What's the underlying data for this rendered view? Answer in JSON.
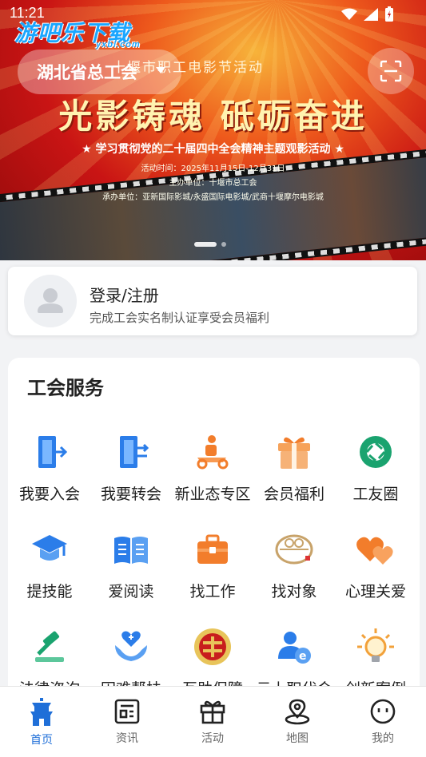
{
  "status_bar": {
    "time": "11:21"
  },
  "watermark": {
    "brand": "游吧乐下载",
    "domain": "yxbl.com"
  },
  "header": {
    "region": "湖北省总工会"
  },
  "banner": {
    "event_line": "十堰市职工电影节活动",
    "headline": "光影铸魂  砥砺奋进",
    "subtitle": "★ 学习贯彻党的二十届四中全会精神主题观影活动 ★",
    "activity_time": "活动时间：2025年11月15日-12月31日",
    "host": "主办单位：十堰市总工会",
    "organizer": "承办单位：亚新国际影城/永盛国际电影城/武商十堰摩尔电影城",
    "page_indicator": {
      "current": 1,
      "total": 2
    }
  },
  "login_card": {
    "title": "登录/注册",
    "description": "完成工会实名制认证享受会员福利"
  },
  "services": {
    "title": "工会服务",
    "items": [
      {
        "label": "我要入会",
        "icon": "join-door-icon"
      },
      {
        "label": "我要转会",
        "icon": "transfer-door-icon"
      },
      {
        "label": "新业态专区",
        "icon": "delivery-scooter-icon"
      },
      {
        "label": "会员福利",
        "icon": "gift-box-icon"
      },
      {
        "label": "工友圈",
        "icon": "camera-aperture-icon"
      },
      {
        "label": "提技能",
        "icon": "graduation-cap-icon"
      },
      {
        "label": "爱阅读",
        "icon": "open-book-icon"
      },
      {
        "label": "找工作",
        "icon": "briefcase-icon"
      },
      {
        "label": "找对象",
        "icon": "couple-rings-icon"
      },
      {
        "label": "心理关爱",
        "icon": "hearts-icon"
      },
      {
        "label": "法律咨询",
        "icon": "gavel-icon"
      },
      {
        "label": "困难帮扶",
        "icon": "helping-hands-icon"
      },
      {
        "label": "互助保障",
        "icon": "union-emblem-icon"
      },
      {
        "label": "云上职代会",
        "icon": "user-e-icon"
      },
      {
        "label": "创新案例",
        "icon": "lightbulb-icon"
      }
    ]
  },
  "tab_bar": {
    "active": "首页",
    "tabs": [
      {
        "label": "首页",
        "icon": "home-pagoda-icon"
      },
      {
        "label": "资讯",
        "icon": "news-icon"
      },
      {
        "label": "活动",
        "icon": "activity-gift-icon"
      },
      {
        "label": "地图",
        "icon": "map-pin-icon"
      },
      {
        "label": "我的",
        "icon": "face-icon"
      }
    ]
  },
  "colors": {
    "accent": "#1f6fd8",
    "banner_red": "#c91414",
    "icon_blue": "#2b7de9",
    "icon_orange": "#f27d2b",
    "icon_green": "#1aa36f"
  }
}
